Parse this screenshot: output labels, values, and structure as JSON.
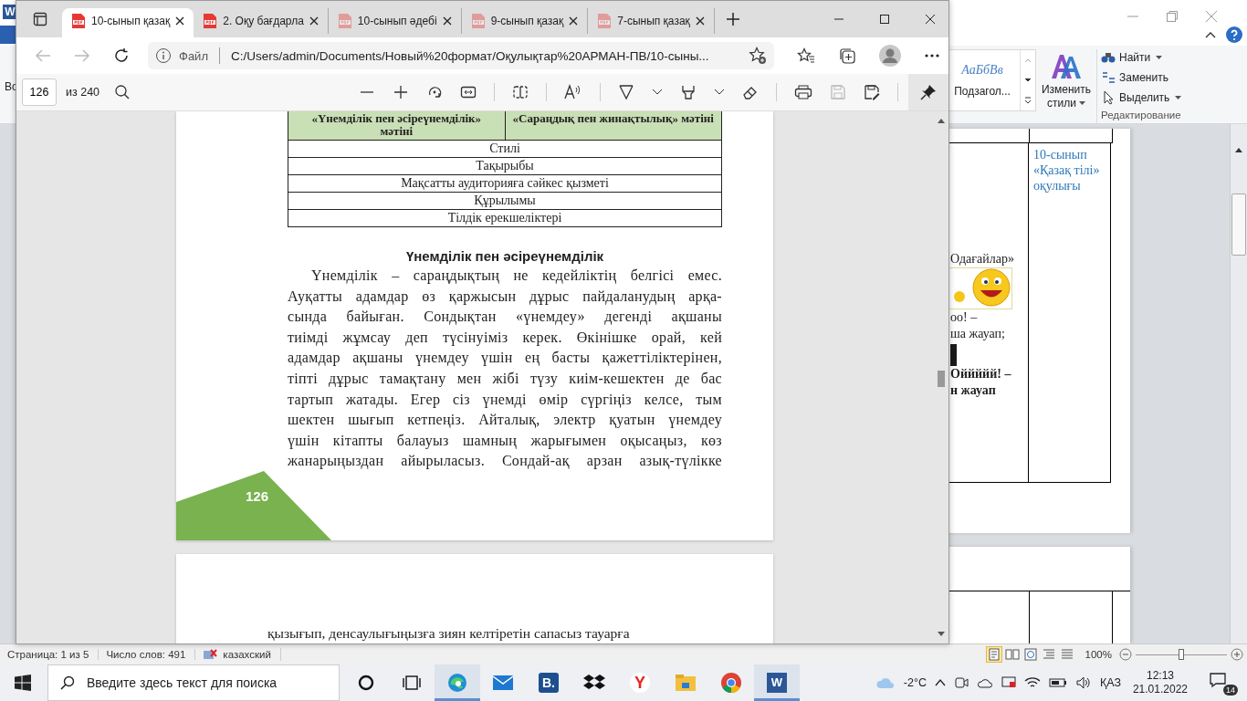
{
  "word": {
    "app_letter": "W",
    "left_text": "Во",
    "ribbon": {
      "style_preview": "AaБбВв",
      "style_name": "Подзагол...",
      "change_styles": "Изменить стили",
      "editing": [
        {
          "kind": "find",
          "label": "Найти",
          "menu": true
        },
        {
          "kind": "replace",
          "label": "Заменить",
          "menu": false
        },
        {
          "kind": "select",
          "label": "Выделить",
          "menu": true
        }
      ],
      "group_label": "Редактирование"
    },
    "document": {
      "cell_1": [
        {
          "kind": "text",
          "text": "Одағайлар»",
          "bold": false
        },
        {
          "kind": "smiley"
        },
        {
          "kind": "text",
          "text": "оо! –",
          "bold": false
        },
        {
          "kind": "text",
          "text": "ша жауап;",
          "bold": false
        },
        {
          "kind": "photo"
        },
        {
          "kind": "text",
          "text": "Оййййй! –",
          "bold": true
        },
        {
          "kind": "text",
          "text": "н жауап",
          "bold": true
        }
      ],
      "cell_2": "10-сынып «Қазақ тілі» оқулығы"
    },
    "status_bar": {
      "page": "Страница: 1 из 5",
      "words": "Число слов: 491",
      "language": "казахский",
      "views": [
        {
          "kind": "print",
          "selected": true
        },
        {
          "kind": "reading",
          "selected": false
        },
        {
          "kind": "web",
          "selected": false
        },
        {
          "kind": "outline",
          "selected": false
        },
        {
          "kind": "draft",
          "selected": false
        }
      ],
      "zoom": "100%",
      "zoom_slider": {
        "level": 0.5
      }
    }
  },
  "browser": {
    "tabs": [
      {
        "title": "10-сынып қазақ",
        "selected": true,
        "dimmed": false
      },
      {
        "title": "2. Оқу бағдарла",
        "selected": false,
        "dimmed": false
      },
      {
        "title": "10-сынып әдебі",
        "selected": false,
        "dimmed": true
      },
      {
        "title": "9-сынып қазақ",
        "selected": false,
        "dimmed": true
      },
      {
        "title": "7-сынып қазақ",
        "selected": false,
        "dimmed": true
      }
    ],
    "address": {
      "scheme": "Файл",
      "url": "C:/Users/admin/Documents/Новый%20формат/Оқулықтар%20АРМАН-ПВ/10-сыны..."
    },
    "pdf_toolbar": {
      "page": "126",
      "page_count": "из 240"
    },
    "page_1": {
      "table": {
        "headers": [
          "«Үнемділік пен әсіреүнемділік» мәтіні",
          "«Сараңдық пен жинақтылық» мәтіні"
        ],
        "rows": [
          "Стилі",
          "Тақырыбы",
          "Мақсатты аудиторияға сәйкес қызметі",
          "Құрылымы",
          "Тілдік ерекшеліктері"
        ]
      },
      "heading": "Үнемділік пен әсіреүнемділік",
      "paragraph_lines": [
        "Үнемділік – сараңдықтың не кедейліктің белгісі емес.",
        "Ауқатты адамдар өз қаржысын дұрыс пайдаланудың арқа-",
        "сында байыған. Сондықтан «үнемдеу» дегенді ақшаны",
        "тиімді жұмсау деп түсінуіміз керек. Өкінішке орай, кей",
        "адамдар ақшаны үнемдеу үшін ең басты қажеттіліктерінен,",
        "тіпті дұрыс тамақтану мен жібі түзу киім-кешектен де бас",
        "тартып жатады. Егер сіз үнемді өмір сүргіңіз келсе, тым",
        "шектен шығып кетпеңіз. Айталық, электр қуатын үнемдеу",
        "үшін кітапты балауыз шамның жарығымен оқысаңыз, көз",
        "жанарыңыздан айырыласыз. Сондай-ақ арзан азық-түлікке"
      ],
      "page_number": "126"
    },
    "page_2": {
      "lines": [
        "қызығып, денсаулығыңызға зиян келтіретін сапасыз тауарға"
      ]
    }
  },
  "taskbar": {
    "search_placeholder": "Введите здесь текст для поиска",
    "apps": [
      {
        "kind": "cortana",
        "active": false
      },
      {
        "kind": "task-view",
        "active": false
      },
      {
        "kind": "edge",
        "active": true
      },
      {
        "kind": "mail",
        "active": false
      },
      {
        "kind": "letter",
        "label": "B.",
        "active": false
      },
      {
        "kind": "dropbox",
        "active": false
      },
      {
        "kind": "yandex",
        "label": "Y",
        "active": false
      },
      {
        "kind": "explorer",
        "active": false
      },
      {
        "kind": "chrome",
        "active": false
      },
      {
        "kind": "word",
        "label": "W",
        "active": true
      }
    ],
    "temperature": "-2°C",
    "language": "ҚАЗ",
    "time": "12:13",
    "date": "21.01.2022",
    "notifications": "14"
  }
}
